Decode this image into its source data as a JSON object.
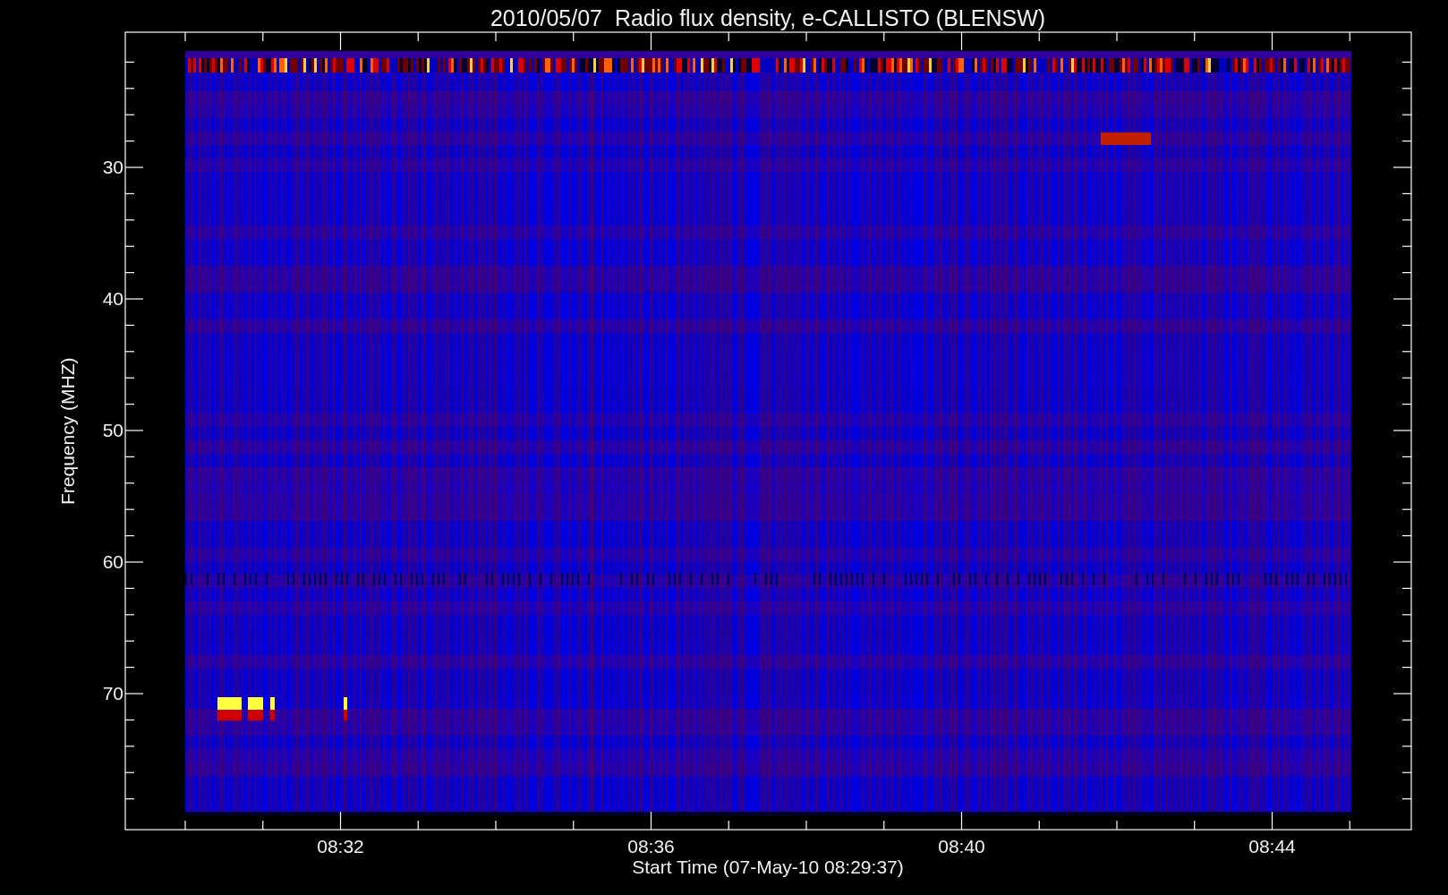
{
  "title": "2010/05/07  Radio flux density, e-CALLISTO (BLENSW)",
  "y_axis": {
    "label": "Frequency (MHZ)",
    "ticks": [
      "30",
      "40",
      "50",
      "60",
      "70"
    ]
  },
  "x_axis": {
    "label": "Start Time (07-May-10 08:29:37)",
    "ticks": [
      "08:32",
      "08:36",
      "08:40",
      "08:44"
    ]
  }
}
